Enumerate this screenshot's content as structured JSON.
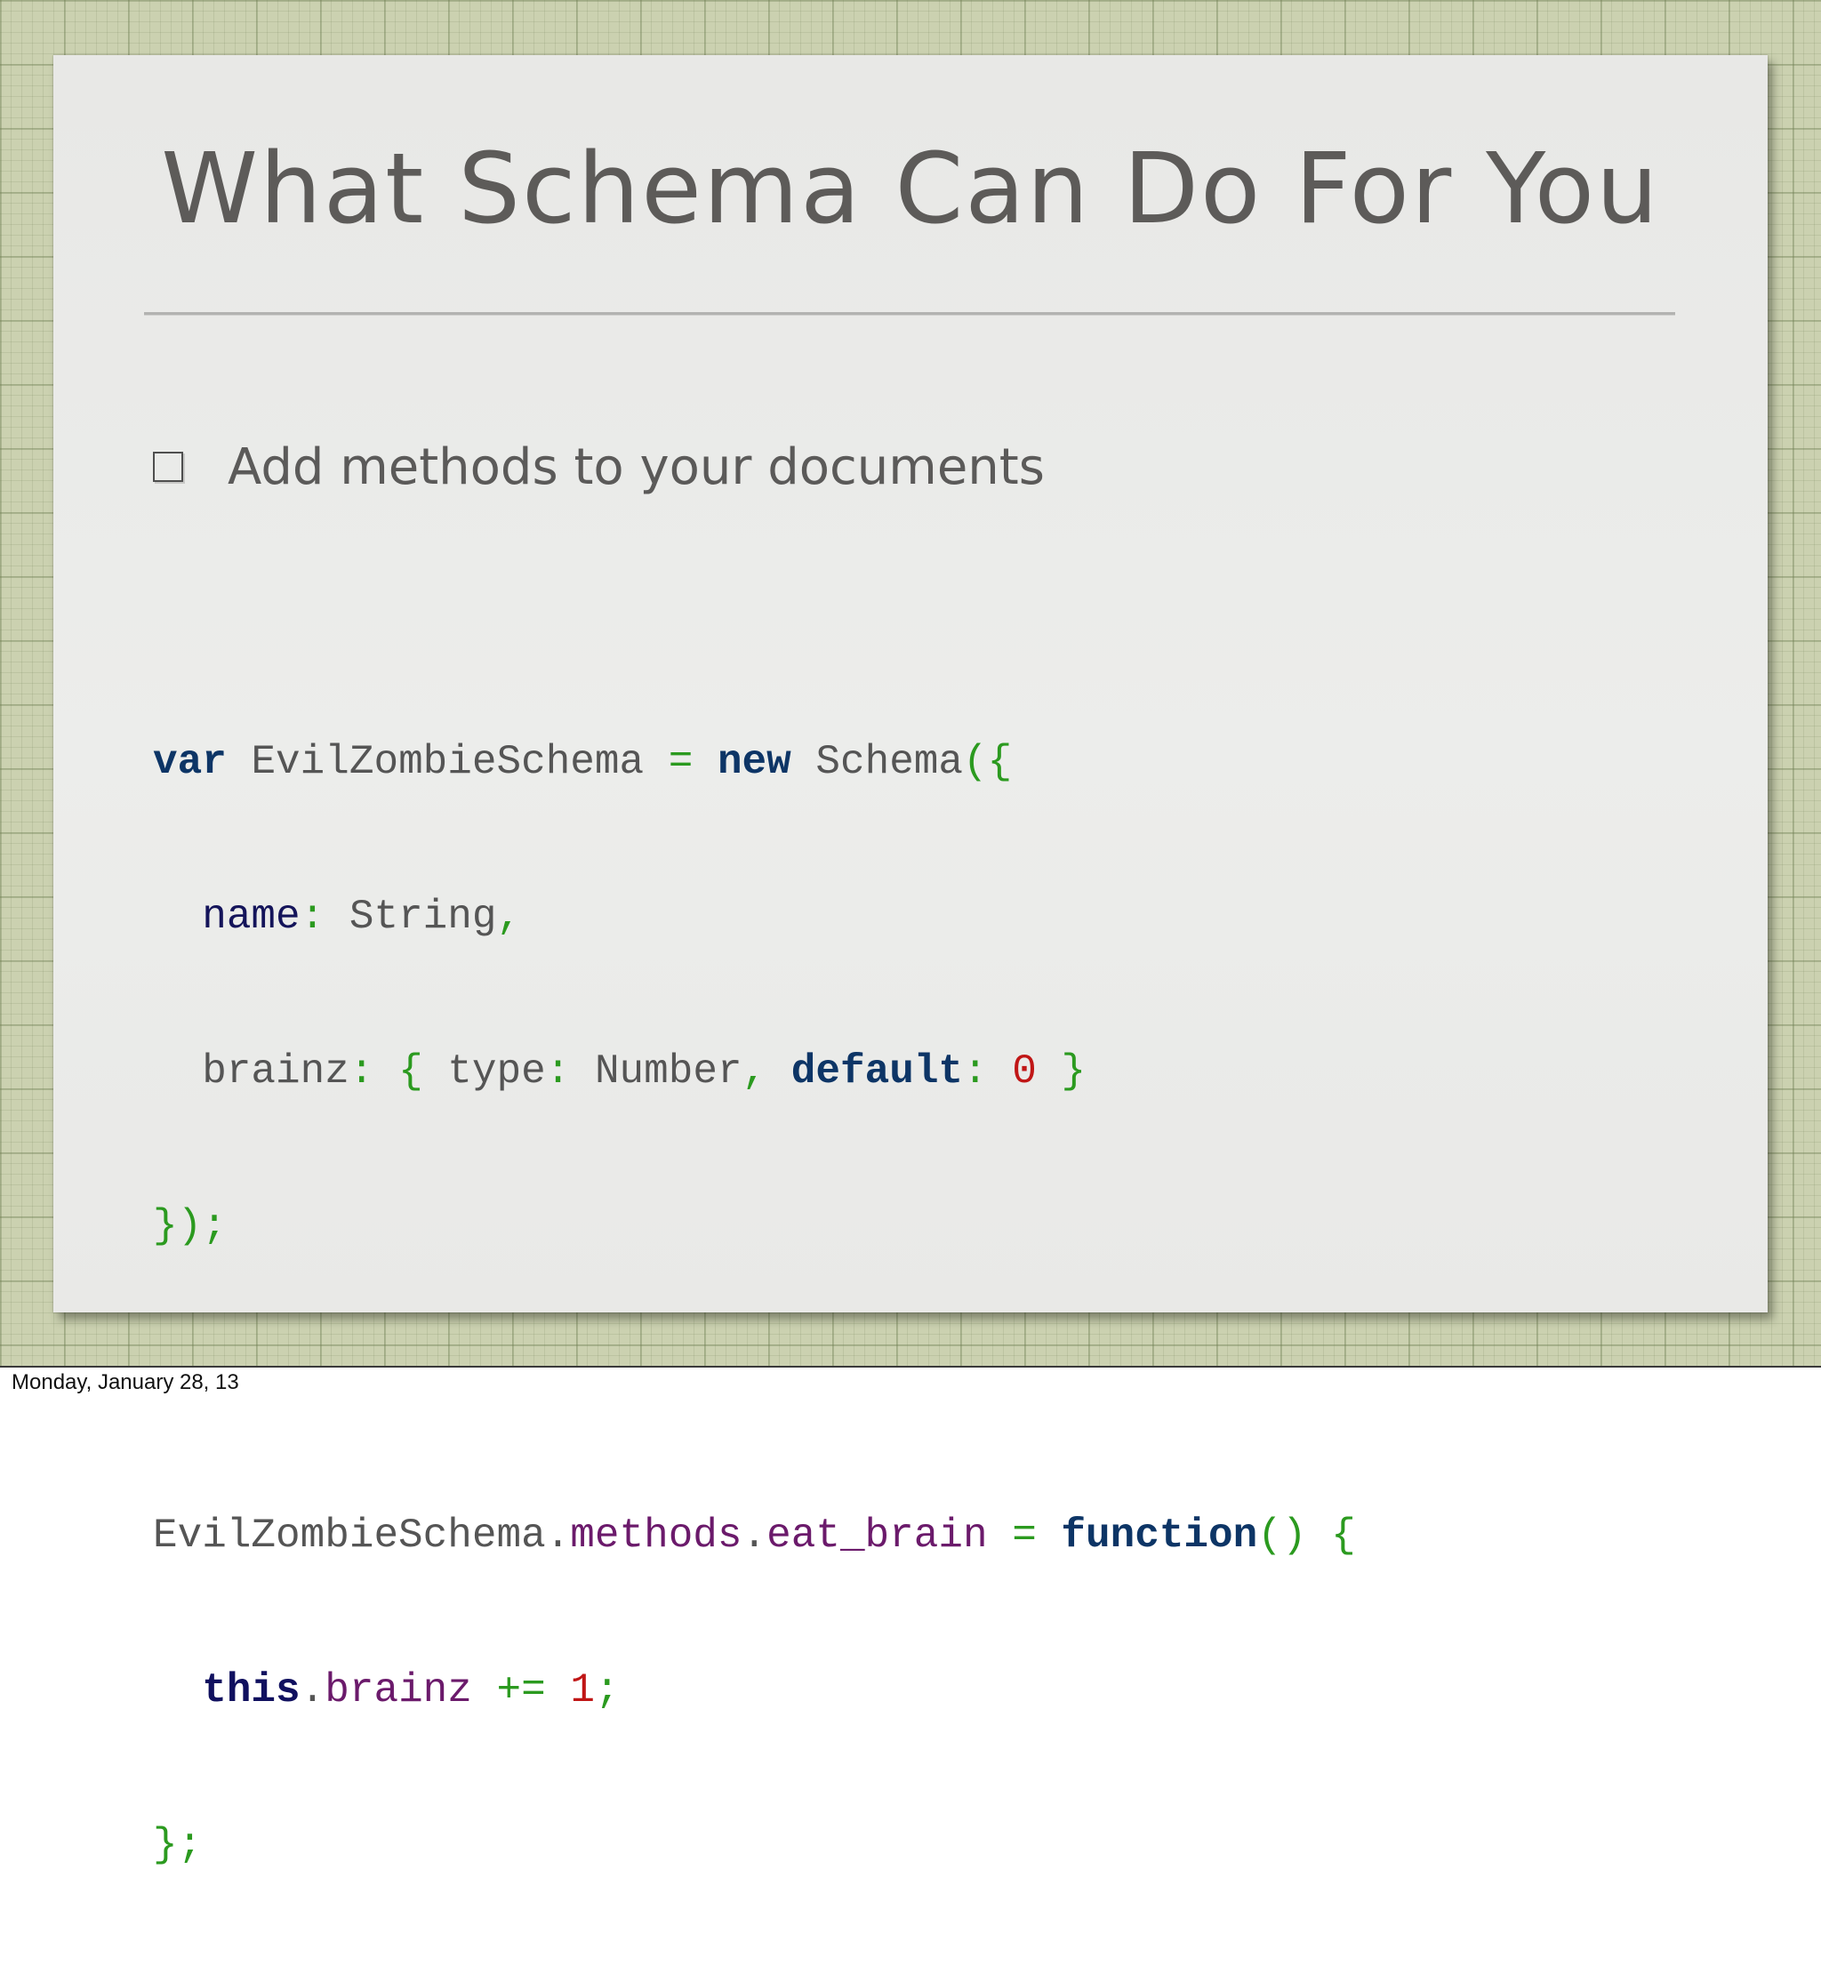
{
  "slide": {
    "title": "What Schema Can Do For You",
    "bullet": "Add methods to your documents"
  },
  "code": {
    "line1": {
      "kw_var": "var",
      "name": "EvilZombieSchema",
      "eq": "=",
      "kw_new": "new",
      "ctor": "Schema",
      "open": "({"
    },
    "line2": {
      "key": "name",
      "colon": ":",
      "value": "String",
      "comma": ","
    },
    "line3": {
      "key": "brainz",
      "colon": ":",
      "lbrace": "{",
      "type_key": "type",
      "type_colon": ":",
      "type_value": "Number",
      "comma": ",",
      "default_key": "default",
      "default_colon": ":",
      "default_value": "0",
      "rbrace": "}"
    },
    "line4": {
      "close": "});"
    },
    "line6": {
      "obj": "EvilZombieSchema",
      "dot1": ".",
      "methods": "methods",
      "dot2": ".",
      "method_name": "eat_brain",
      "eq": "=",
      "kw_function": "function",
      "parens": "()",
      "lbrace": "{"
    },
    "line7": {
      "kw_this": "this",
      "dot": ".",
      "prop": "brainz",
      "op": "+=",
      "num": "1",
      "semi": ";"
    },
    "line8": {
      "close": "};"
    }
  },
  "footer": {
    "date": "Monday, January 28, 13"
  }
}
